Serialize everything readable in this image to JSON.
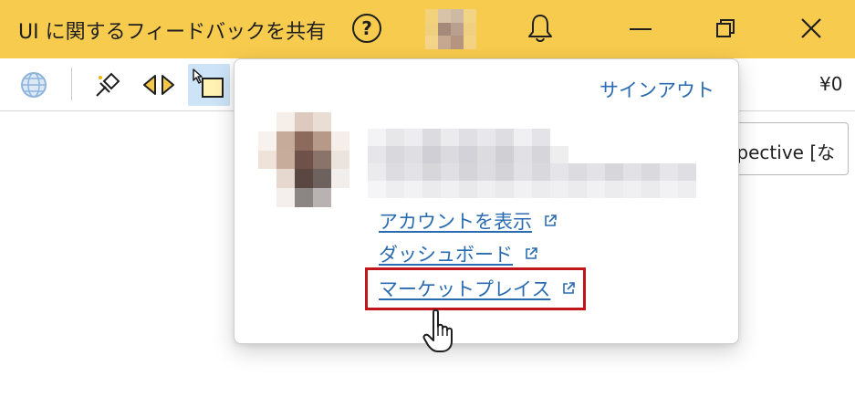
{
  "window": {
    "title": "UI に関するフィードバックを共有",
    "help_glyph": "?",
    "accent_color": "#f7cb4d"
  },
  "toolbar": {
    "currency": "¥0",
    "perspective_label": "spective [な"
  },
  "account_popup": {
    "signout_label": "サインアウト",
    "links": [
      {
        "label": "アカウントを表示",
        "icon": "external-link-icon"
      },
      {
        "label": "ダッシュボード",
        "icon": "external-link-icon"
      },
      {
        "label": "マーケットプレイス",
        "icon": "external-link-icon"
      }
    ],
    "link_color": "#2b6cb0",
    "highlight_color": "#c0151b"
  }
}
